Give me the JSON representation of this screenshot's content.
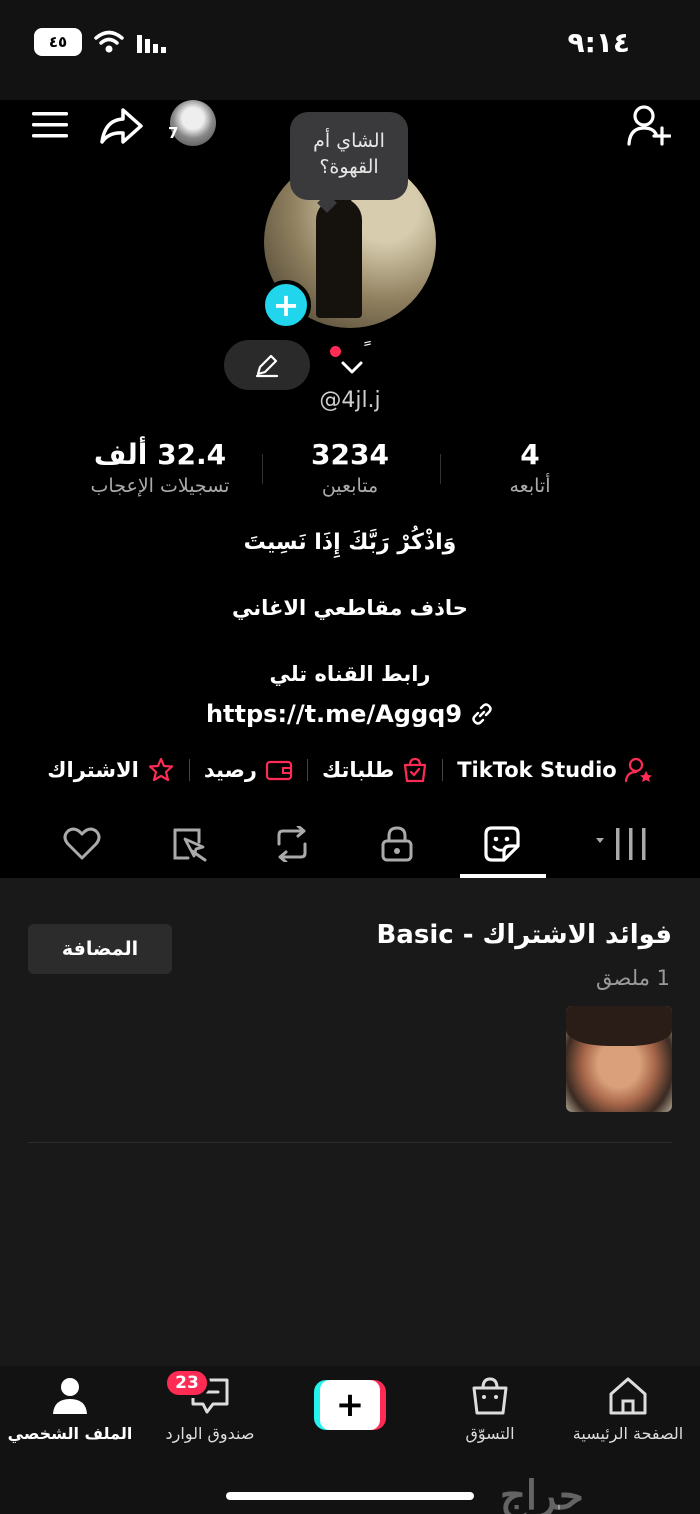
{
  "status_bar": {
    "time": "٩:١٤",
    "battery": "٤٥"
  },
  "story": {
    "count": "7"
  },
  "profile": {
    "note": "الشاي أم القهوة؟",
    "name_mark": "ً",
    "username": "@4jl.j"
  },
  "stats": [
    {
      "value": "4",
      "label": "أتابعه"
    },
    {
      "value": "3234",
      "label": "متابعين"
    },
    {
      "value": "32.4 ألف",
      "label": "تسجيلات الإعجاب"
    }
  ],
  "bio": {
    "line1": "وَاذْكُرْ رَبَّكَ إِذَا نَسِيتَ",
    "line2": "حاذف مقاطعي الاغاني",
    "line3": "رابط القناه تلي",
    "link": "https://t.me/Aggq9"
  },
  "chips": [
    {
      "label": "TikTok Studio",
      "icon": "person-star-icon"
    },
    {
      "label": "طلباتك",
      "icon": "bag-check-icon"
    },
    {
      "label": "رصيد",
      "icon": "wallet-icon"
    },
    {
      "label": "الاشتراك",
      "icon": "star-badge-icon"
    }
  ],
  "tabs": [
    "grid-icon",
    "sticker-icon",
    "lock-icon",
    "repost-icon",
    "tagged-icon",
    "heart-icon"
  ],
  "active_tab": "sticker-icon",
  "stickers": {
    "title": "فوائد الاشتراك - Basic",
    "count": "1 ملصق",
    "added_label": "المضافة"
  },
  "bottom_nav": {
    "home": "الصفحة الرئيسية",
    "shop": "التسوّق",
    "inbox": "صندوق الوارد",
    "inbox_badge": "23",
    "profile": "الملف الشخصي"
  },
  "watermark": "حراج",
  "colors": {
    "accent_red": "#fe2c55",
    "accent_cyan": "#25f4ee",
    "add_blue": "#20d5ec",
    "background": "#000000"
  }
}
